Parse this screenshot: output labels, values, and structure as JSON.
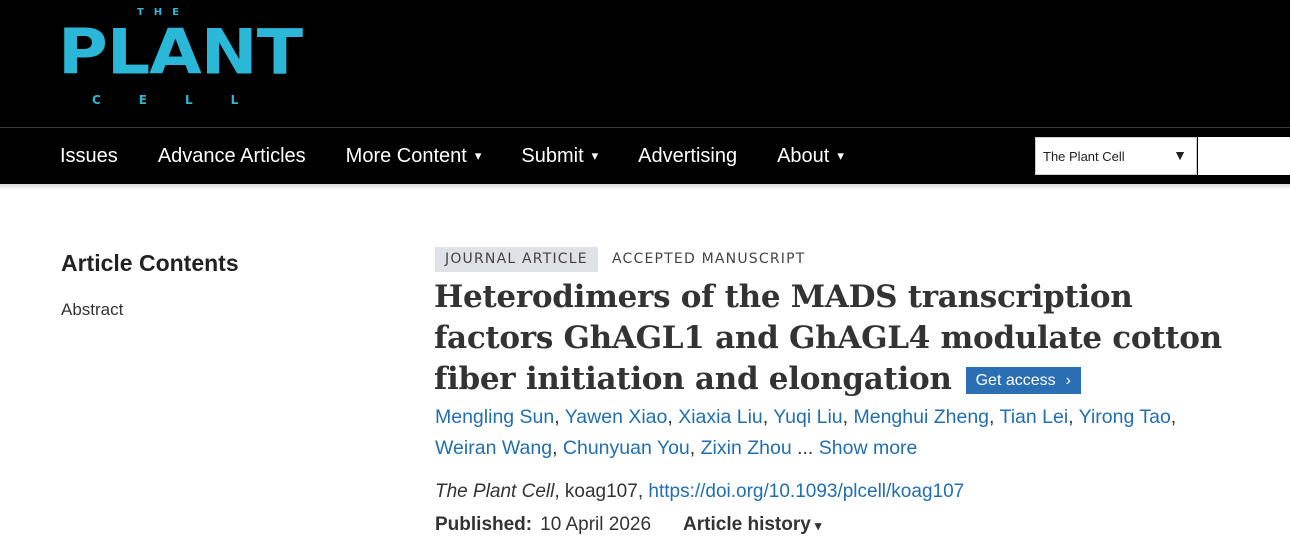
{
  "logo": {
    "top_text": "THE",
    "main_text": "PLANT",
    "bottom_text": "CELL",
    "color": "#2bb7d7"
  },
  "nav": {
    "items": [
      {
        "label": "Issues",
        "has_dropdown": false
      },
      {
        "label": "Advance Articles",
        "has_dropdown": false
      },
      {
        "label": "More Content",
        "has_dropdown": true
      },
      {
        "label": "Submit",
        "has_dropdown": true
      },
      {
        "label": "Advertising",
        "has_dropdown": false
      },
      {
        "label": "About",
        "has_dropdown": true
      }
    ],
    "dropdown_caret": "▾",
    "site_select": {
      "value": "The Plant Cell",
      "caret": "▼"
    }
  },
  "sidebar": {
    "title": "Article Contents",
    "items": [
      "Abstract"
    ]
  },
  "article": {
    "type": "JOURNAL ARTICLE",
    "status": "ACCEPTED MANUSCRIPT",
    "title": "Heterodimers of the MADS transcription factors GhAGL1 and GhAGL4 modulate cotton fiber initiation and elongation",
    "access_button": {
      "label": "Get access",
      "chevron": "›",
      "color": "#2a6eb3"
    },
    "authors": [
      "Mengling Sun",
      "Yawen Xiao",
      "Xiaxia Liu",
      "Yuqi Liu",
      "Menghui Zheng",
      "Tian Lei",
      "Yirong Tao",
      "Weiran Wang",
      "Chunyuan You",
      "Zixin Zhou"
    ],
    "authors_ellipsis": " ... ",
    "show_more": "Show more",
    "citation": {
      "journal": "The Plant Cell",
      "separator": ", ",
      "article_id": "koag107",
      "doi": "https://doi.org/10.1093/plcell/koag107"
    },
    "published_label": "Published:",
    "published_date": "10 April 2026",
    "history_label": "Article history",
    "history_caret": "▾"
  },
  "colors": {
    "header_bg": "#000000",
    "link": "#1f6fb2",
    "badge_bg": "#dfe3e8"
  }
}
